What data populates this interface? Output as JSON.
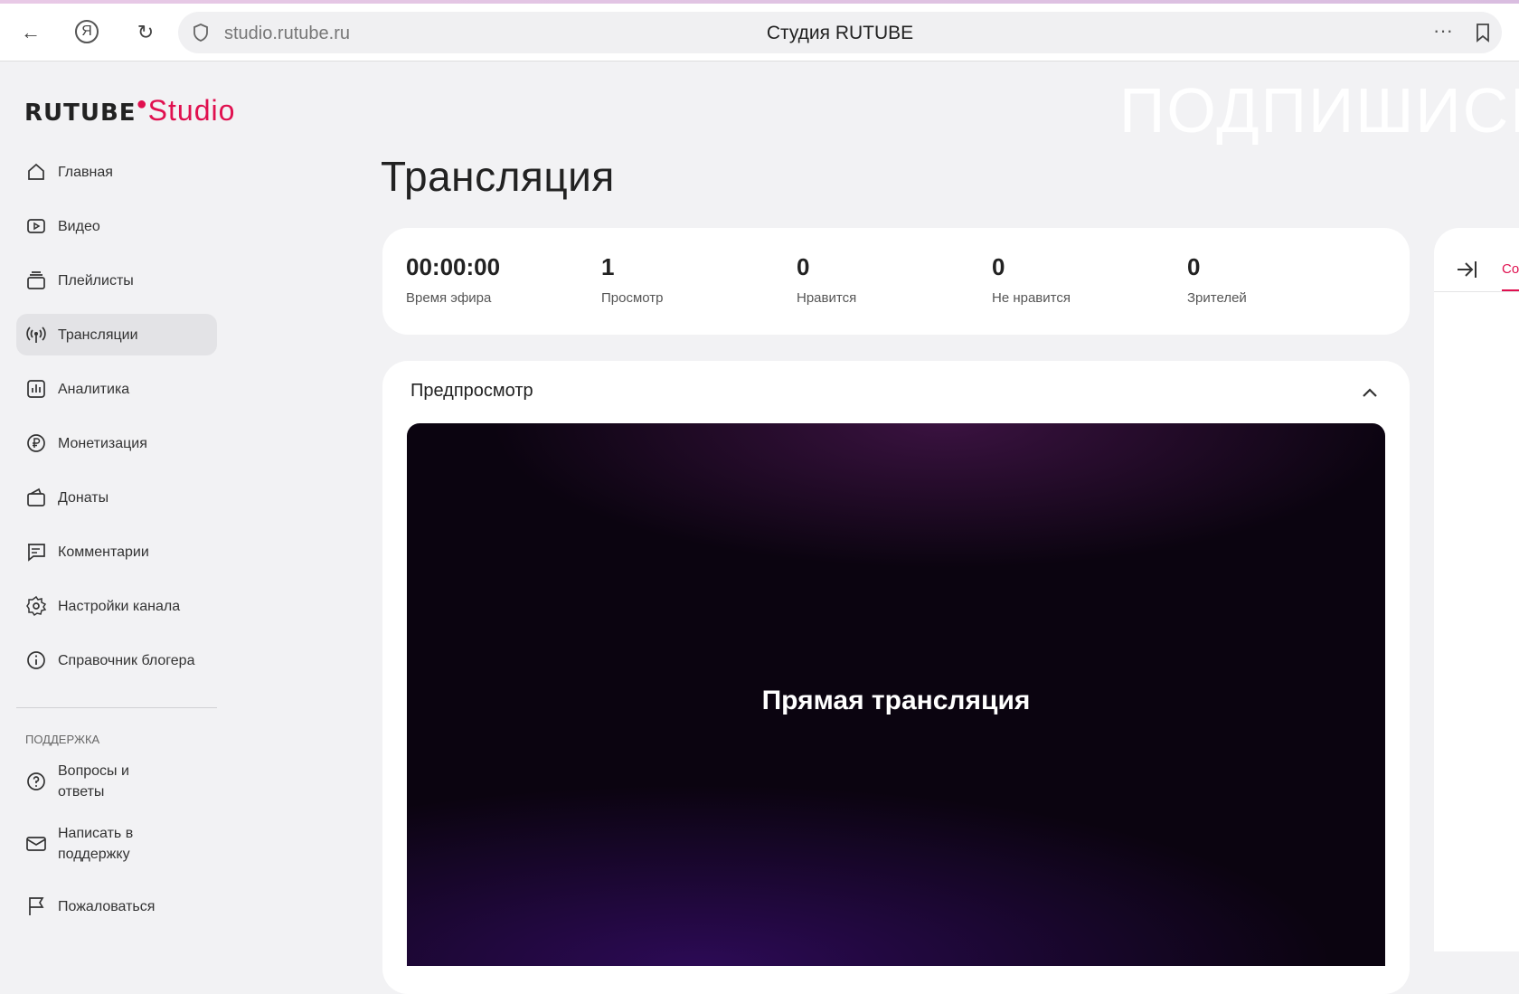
{
  "browser": {
    "url": "studio.rutube.ru",
    "title": "Студия RUTUBE"
  },
  "logo": {
    "brand": "RUTUBE",
    "product": "Studio"
  },
  "watermark": "ПОДПИШИСЬ",
  "sidebar": {
    "items": [
      {
        "label": "Главная",
        "icon": "home-icon"
      },
      {
        "label": "Видео",
        "icon": "video-icon"
      },
      {
        "label": "Плейлисты",
        "icon": "playlist-icon"
      },
      {
        "label": "Трансляции",
        "icon": "broadcast-icon",
        "active": true
      },
      {
        "label": "Аналитика",
        "icon": "analytics-icon"
      },
      {
        "label": "Монетизация",
        "icon": "ruble-icon"
      },
      {
        "label": "Донаты",
        "icon": "wallet-icon"
      },
      {
        "label": "Комментарии",
        "icon": "comment-icon"
      },
      {
        "label": "Настройки канала",
        "icon": "gear-icon"
      },
      {
        "label": "Справочник блогера",
        "icon": "info-icon"
      }
    ],
    "support_heading": "ПОДДЕРЖКА",
    "support": [
      {
        "label": "Вопросы и ответы",
        "icon": "question-icon"
      },
      {
        "label": "Написать в поддержку",
        "icon": "mail-icon"
      },
      {
        "label": "Пожаловаться",
        "icon": "flag-icon"
      }
    ]
  },
  "page": {
    "title": "Трансляция"
  },
  "stats": [
    {
      "value": "00:00:00",
      "label": "Время эфира"
    },
    {
      "value": "1",
      "label": "Просмотр"
    },
    {
      "value": "0",
      "label": "Нравится"
    },
    {
      "value": "0",
      "label": "Не нравится"
    },
    {
      "value": "0",
      "label": "Зрителей"
    }
  ],
  "preview": {
    "heading": "Предпросмотр",
    "video_text": "Прямая трансляция"
  },
  "right_panel": {
    "tab": "Со"
  }
}
